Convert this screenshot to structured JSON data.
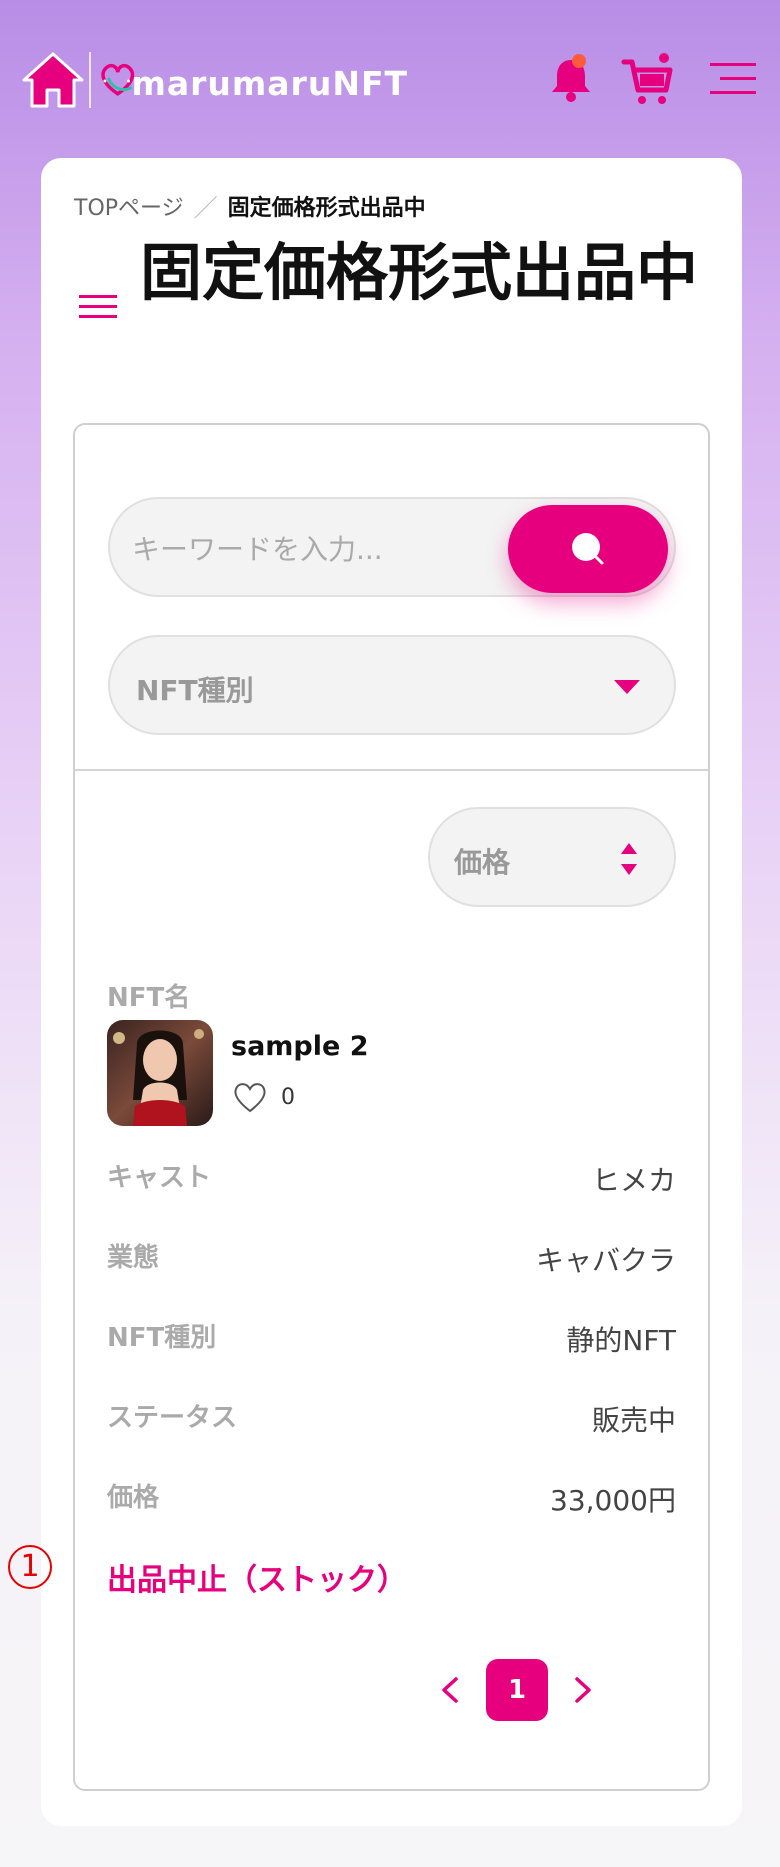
{
  "header": {
    "logo_text": "marumaruNFT",
    "icons": {
      "home": "home-icon",
      "bell": "bell-icon",
      "cart": "cart-icon",
      "menu": "hamburger-menu-icon"
    }
  },
  "breadcrumb": {
    "home": "TOPページ",
    "separator": "／",
    "current": "固定価格形式出品中"
  },
  "page_title": "固定価格形式出品中",
  "search": {
    "placeholder": "キーワードを入力..."
  },
  "filters": {
    "nft_type_label": "NFT種別",
    "sort_label": "価格"
  },
  "item": {
    "name_label": "NFT名",
    "name": "sample 2",
    "likes": "0",
    "rows": [
      {
        "label": "キャスト",
        "value": "ヒメカ"
      },
      {
        "label": "業態",
        "value": "キャバクラ"
      },
      {
        "label": "NFT種別",
        "value": "静的NFT"
      },
      {
        "label": "ステータス",
        "value": "販売中"
      },
      {
        "label": "価格",
        "value": "33,000円"
      }
    ],
    "action": "出品中止（ストック）"
  },
  "pagination": {
    "current": "1"
  },
  "annotation": "1",
  "colors": {
    "accent": "#e6007e",
    "label": "#aaaaaa"
  }
}
